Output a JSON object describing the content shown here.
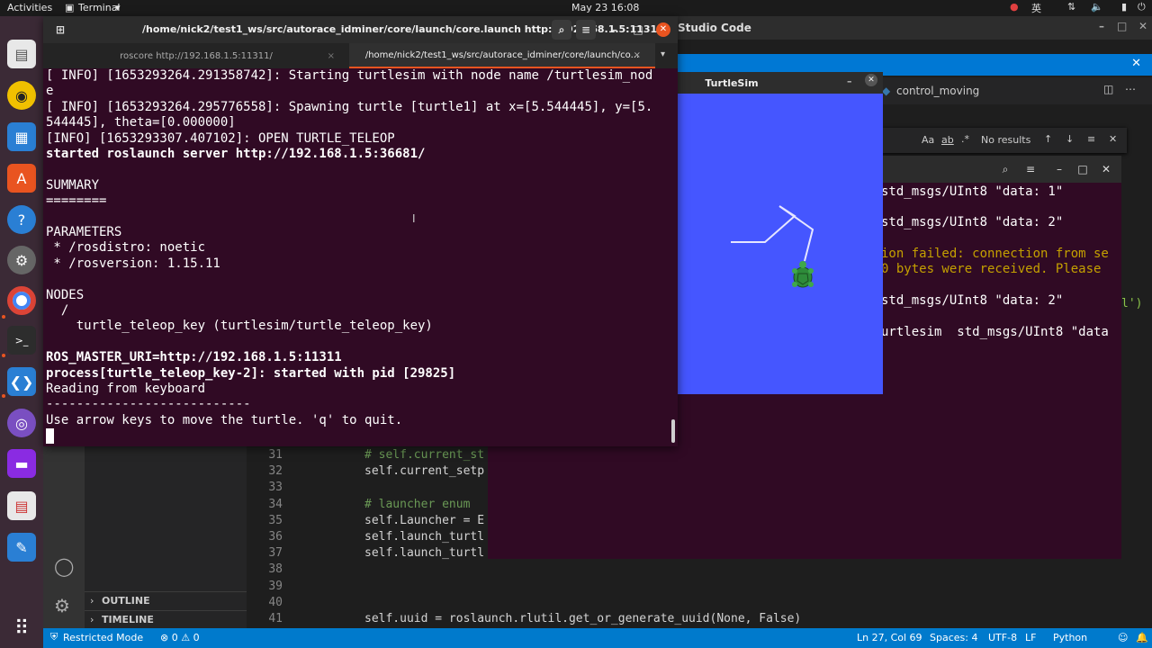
{
  "topbar": {
    "activities": "Activities",
    "app_name": "Terminal",
    "clock": "May 23  16:08",
    "input_method": "英"
  },
  "vscode": {
    "title": "Studio Code",
    "tab_label": "control_moving",
    "find": {
      "result": "No results"
    },
    "sidebar": {
      "outline": "OUTLINE",
      "timeline": "TIMELINE"
    },
    "editor_lines": [
      {
        "num": "31",
        "text": "# self.current_st",
        "kind": "comment"
      },
      {
        "num": "32",
        "text": "self.current_setp",
        "kind": "code"
      },
      {
        "num": "33",
        "text": "",
        "kind": "code"
      },
      {
        "num": "34",
        "text": "# launcher enum",
        "kind": "comment"
      },
      {
        "num": "35",
        "text": "self.Launcher = E",
        "kind": "code"
      },
      {
        "num": "36",
        "text": "self.launch_turtl",
        "kind": "code"
      },
      {
        "num": "37",
        "text": "self.launch_turtl",
        "kind": "code"
      },
      {
        "num": "38",
        "text": "",
        "kind": "code"
      },
      {
        "num": "39",
        "text": "",
        "kind": "code"
      },
      {
        "num": "40",
        "text": "",
        "kind": "code"
      },
      {
        "num": "41",
        "text": "self.uuid = roslaunch.rlutil.get_or_generate_uuid(None, False)",
        "kind": "code"
      }
    ],
    "status": {
      "restricted": "Restricted Mode",
      "problems": "⊗ 0 ⚠ 0",
      "cursor": "Ln 27, Col 69",
      "spaces": "Spaces: 4",
      "encoding": "UTF-8",
      "eol": "LF",
      "language": "Python"
    }
  },
  "terminal2": {
    "lines": [
      {
        "text": "std_msgs/UInt8 \"data: 1\"",
        "warn": false
      },
      {
        "text": "std_msgs/UInt8 \"data: 2\"",
        "warn": false
      },
      {
        "text": "ion failed: connection from se",
        "warn": true
      },
      {
        "text": "0 bytes were received. Please",
        "warn": true
      },
      {
        "text": "std_msgs/UInt8 \"data: 2\"",
        "warn": false
      },
      {
        "text": "urtlesim  std_msgs/UInt8 \"data",
        "warn": false
      }
    ],
    "edge_fragment": "l')"
  },
  "turtlesim": {
    "title": "TurtleSim",
    "bg_color": "#4556ff"
  },
  "terminal": {
    "title": "/home/nick2/test1_ws/src/autorace_idminer/core/launch/core.launch http://192.168.1.5:11311",
    "tabs": [
      {
        "label": "roscore http://192.168.1.5:11311/",
        "active": false
      },
      {
        "label": "/home/nick2/test1_ws/src/autorace_idminer/core/launch/co...",
        "active": true
      }
    ],
    "lines": [
      {
        "text": "[ INFO] [1653293264.291358742]: Starting turtlesim with node name /turtlesim_nod",
        "bold": false
      },
      {
        "text": "e",
        "bold": false
      },
      {
        "text": "[ INFO] [1653293264.295776558]: Spawning turtle [turtle1] at x=[5.544445], y=[5.",
        "bold": false
      },
      {
        "text": "544445], theta=[0.000000]",
        "bold": false
      },
      {
        "text": "[INFO] [1653293307.407102]: OPEN TURTLE_TELEOP",
        "bold": false
      },
      {
        "text": "started roslaunch server http://192.168.1.5:36681/",
        "bold": true
      },
      {
        "text": "",
        "bold": false
      },
      {
        "text": "SUMMARY",
        "bold": false
      },
      {
        "text": "========",
        "bold": false
      },
      {
        "text": "",
        "bold": false
      },
      {
        "text": "PARAMETERS",
        "bold": false
      },
      {
        "text": " * /rosdistro: noetic",
        "bold": false
      },
      {
        "text": " * /rosversion: 1.15.11",
        "bold": false
      },
      {
        "text": "",
        "bold": false
      },
      {
        "text": "NODES",
        "bold": false
      },
      {
        "text": "  /",
        "bold": false
      },
      {
        "text": "    turtle_teleop_key (turtlesim/turtle_teleop_key)",
        "bold": false
      },
      {
        "text": "",
        "bold": false
      },
      {
        "text": "ROS_MASTER_URI=http://192.168.1.5:11311",
        "bold": true
      },
      {
        "text": "process[turtle_teleop_key-2]: started with pid [29825]",
        "bold": true
      },
      {
        "text": "Reading from keyboard",
        "bold": false
      },
      {
        "text": "---------------------------",
        "bold": false
      },
      {
        "text": "Use arrow keys to move the turtle. 'q' to quit.",
        "bold": false
      }
    ]
  }
}
